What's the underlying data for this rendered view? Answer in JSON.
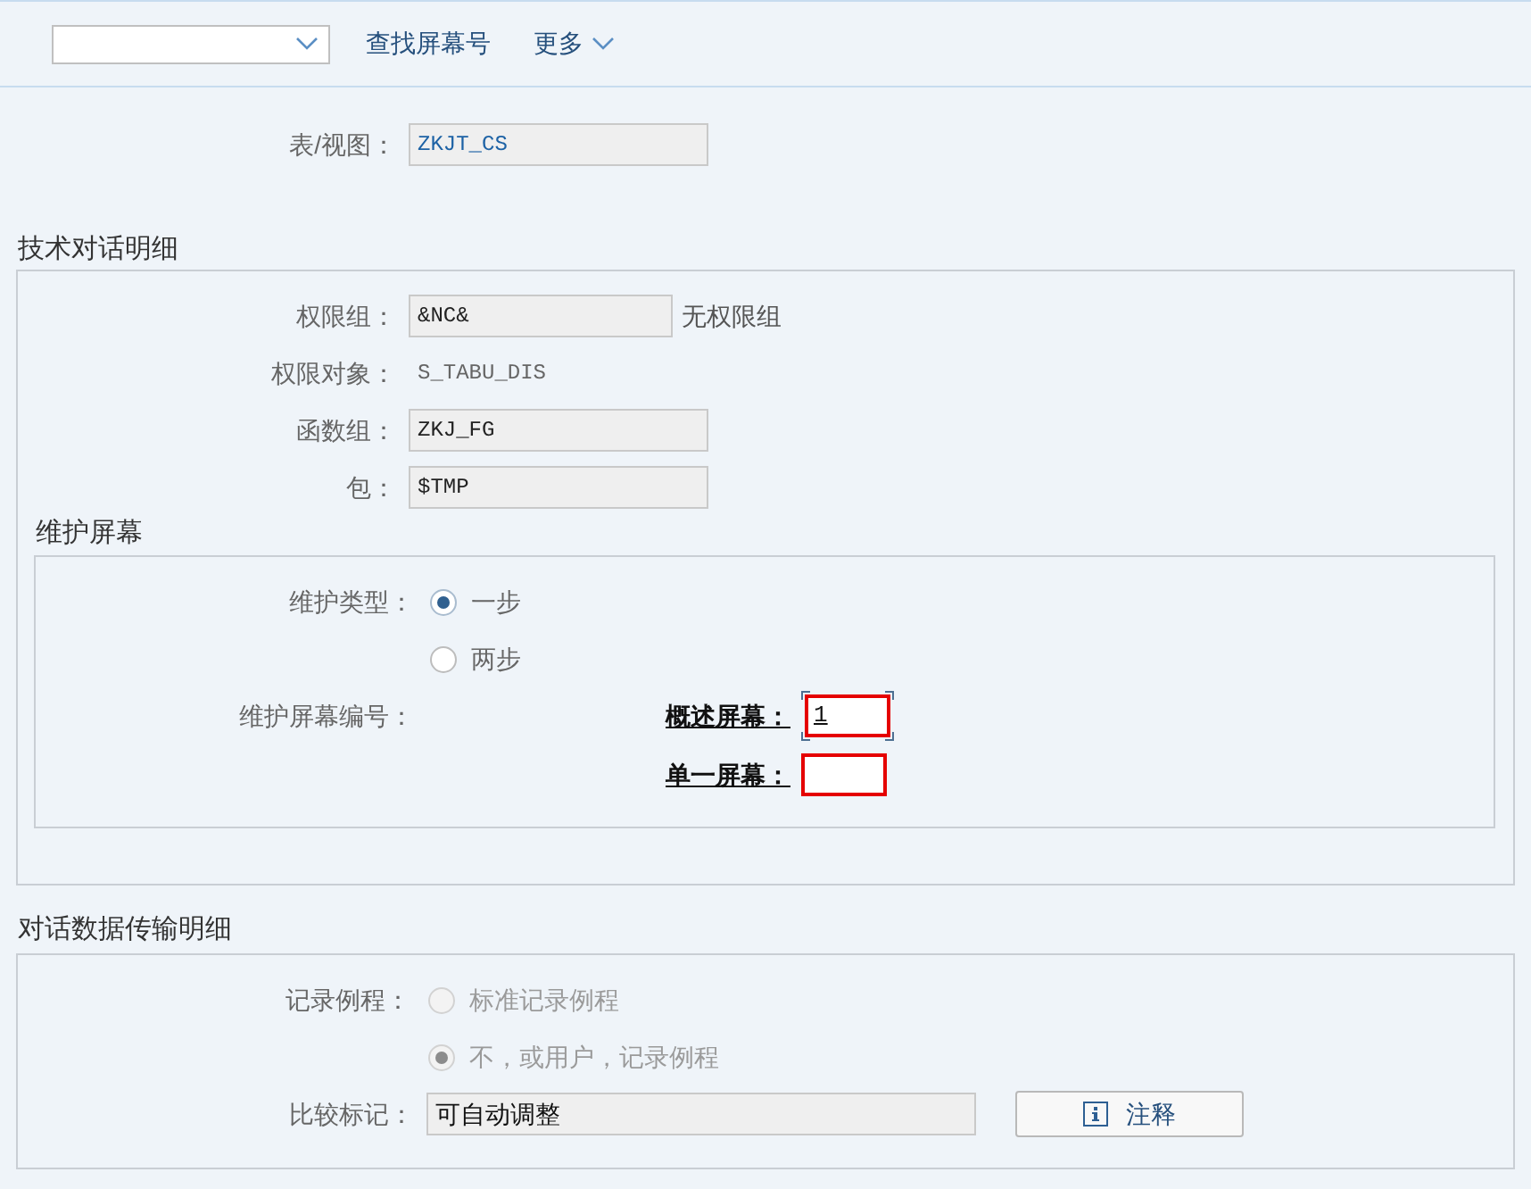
{
  "toolbar": {
    "actions": [
      {
        "kind": "link",
        "label": "查找屏幕号"
      },
      {
        "kind": "menu",
        "label": "更多"
      }
    ]
  },
  "table_view": {
    "label": "表/视图：",
    "value": "ZKJT_CS"
  },
  "technical_dialog": {
    "title": "技术对话明细",
    "rows": [
      {
        "kind": "field",
        "label": "权限组：",
        "value": "&NC&",
        "note": "无权限组"
      },
      {
        "kind": "text",
        "label": "权限对象：",
        "value": "S_TABU_DIS"
      },
      {
        "kind": "field",
        "label": "函数组：",
        "value": "ZKJ_FG"
      },
      {
        "kind": "field",
        "label": "包：",
        "value": "$TMP"
      }
    ],
    "maintenance_screen": {
      "title": "维护屏幕",
      "type_label": "维护类型：",
      "types": [
        {
          "label": "一步",
          "selected": true
        },
        {
          "label": "两步",
          "selected": false
        }
      ],
      "number_label": "维护屏幕编号：",
      "screens": [
        {
          "label": "概述屏幕：",
          "value": "1",
          "focused": true,
          "error": true
        },
        {
          "label": "单一屏幕：",
          "focused": false,
          "error": true
        }
      ]
    }
  },
  "data_transfer": {
    "title": "对话数据传输明细",
    "routine_label": "记录例程：",
    "routines": [
      {
        "label": "标准记录例程",
        "selected": false,
        "disabled": true
      },
      {
        "label": "不，或用户，记录例程",
        "selected": true,
        "disabled": true
      }
    ],
    "compare": {
      "label": "比较标记：",
      "value": "可自动调整"
    },
    "note_button": {
      "label": "注释"
    }
  }
}
